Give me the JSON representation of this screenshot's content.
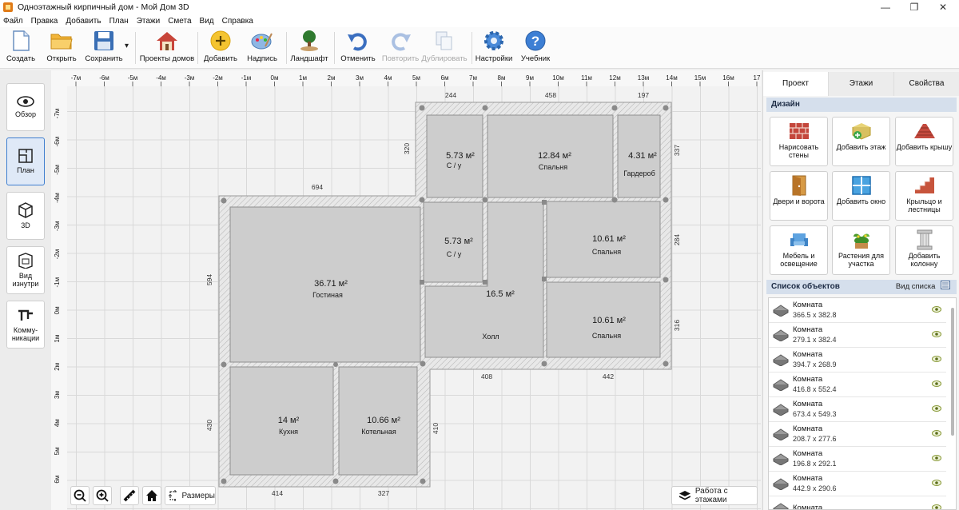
{
  "window": {
    "title": "Одноэтажный кирпичный дом - Мой Дом 3D",
    "controls": {
      "minimize": "—",
      "restore": "❐",
      "close": "✕"
    }
  },
  "menu": [
    "Файл",
    "Правка",
    "Добавить",
    "План",
    "Этажи",
    "Смета",
    "Вид",
    "Справка"
  ],
  "toolbar": {
    "create": "Создать",
    "open": "Открыть",
    "save": "Сохранить",
    "save_dropdown": "▾",
    "projects": "Проекты домов",
    "add": "Добавить",
    "label": "Надпись",
    "landscape": "Ландшафт",
    "undo": "Отменить",
    "redo": "Повторить",
    "duplicate": "Дублировать",
    "settings": "Настройки",
    "tutorial": "Учебник"
  },
  "views": {
    "overview": "Обзор",
    "plan": "План",
    "view3d": "3D",
    "inside": "Вид изнутри",
    "comms": "Комму-никации",
    "active": "plan"
  },
  "ruler": {
    "top": [
      "-7м",
      "-6м",
      "-5м",
      "-4м",
      "-3м",
      "-2м",
      "-1м",
      "0м",
      "1м",
      "2м",
      "3м",
      "4м",
      "5м",
      "6м",
      "7м",
      "8м",
      "9м",
      "10м",
      "11м",
      "12м",
      "13м",
      "14м",
      "15м",
      "16м",
      "17"
    ],
    "left": [
      "-7м",
      "-6м",
      "-5м",
      "-4м",
      "-3м",
      "-2м",
      "-1м",
      "0м",
      "1м",
      "2м",
      "3м",
      "4м",
      "5м",
      "6м"
    ]
  },
  "plan": {
    "dimensions": {
      "top_244": "244",
      "top_458": "458",
      "top_197": "197",
      "left_694": "694",
      "right_337": "337",
      "left_320": "320",
      "right_284": "284",
      "left_594": "594",
      "right_316": "316",
      "bottom_408": "408",
      "bottom_442": "442",
      "left_430": "430",
      "right_410": "410",
      "bottom_414": "414",
      "bottom_327": "327"
    },
    "rooms": [
      {
        "area": "5.73 м²",
        "name": "С / у"
      },
      {
        "area": "12.84 м²",
        "name": "Спальня"
      },
      {
        "area": "4.31 м²",
        "name": "Гардероб"
      },
      {
        "area": "5.73 м²",
        "name": "С / у"
      },
      {
        "area": "10.61 м²",
        "name": "Спальня"
      },
      {
        "area": "36.71 м²",
        "name": "Гостиная"
      },
      {
        "area": "16.5 м²",
        "name": "Холл"
      },
      {
        "area": "10.61 м²",
        "name": "Спальня"
      },
      {
        "area": "14 м²",
        "name": "Кухня"
      },
      {
        "area": "10.66 м²",
        "name": "Котельная"
      }
    ]
  },
  "canvas_buttons": {
    "sizes": "Размеры",
    "floors": "Работа с этажами"
  },
  "rightpanel": {
    "tabs": [
      "Проект",
      "Этажи",
      "Свойства"
    ],
    "active_tab": "Проект",
    "design_header": "Дизайн",
    "design": {
      "walls": "Нарисовать стены",
      "floor": "Добавить этаж",
      "roof": "Добавить крышу",
      "doors": "Двери и ворота",
      "window": "Добавить окно",
      "stairs": "Крыльцо и лестницы",
      "furniture": "Мебель и освещение",
      "plants": "Растения для участка",
      "column": "Добавить колонну"
    },
    "objects_header": "Список объектов",
    "list_view": "Вид списка",
    "objects": [
      {
        "name": "Комната",
        "dims": "366.5 x 382.8"
      },
      {
        "name": "Комната",
        "dims": "279.1 x 382.4"
      },
      {
        "name": "Комната",
        "dims": "394.7 x 268.9"
      },
      {
        "name": "Комната",
        "dims": "416.8 x 552.4"
      },
      {
        "name": "Комната",
        "dims": "673.4 x 549.3"
      },
      {
        "name": "Комната",
        "dims": "208.7 x 277.6"
      },
      {
        "name": "Комната",
        "dims": "196.8 x 292.1"
      },
      {
        "name": "Комната",
        "dims": "442.9 x 290.6"
      },
      {
        "name": "Комната",
        "dims": ""
      }
    ]
  },
  "colors": {
    "accent": "#3f7fd0",
    "section_header": "#d5dfec",
    "room_fill": "#cdcdcd",
    "wall_fill": "#e8e8e8"
  }
}
